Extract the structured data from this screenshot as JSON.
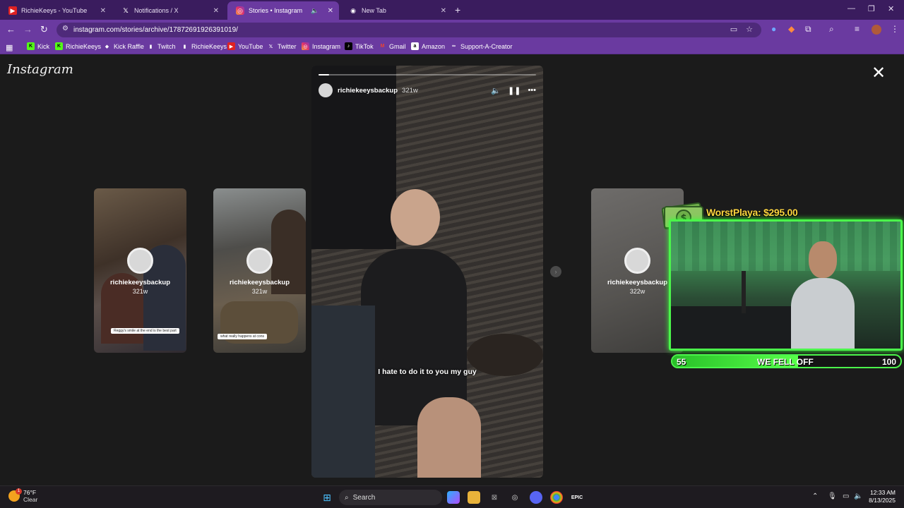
{
  "browser": {
    "tabs": [
      {
        "label": "RichieKeeys - YouTube",
        "icon": "youtube-icon",
        "active": false
      },
      {
        "label": "Notifications / X",
        "icon": "x-icon",
        "active": false
      },
      {
        "label": "Stories • Instagram",
        "icon": "instagram-icon",
        "active": true
      },
      {
        "label": "New Tab",
        "icon": "chrome-icon",
        "active": false
      }
    ],
    "url": "instagram.com/stories/archive/17872691926391019/",
    "bookmarks": [
      {
        "label": "Kick",
        "icon": "kick-icon"
      },
      {
        "label": "RichieKeeys",
        "icon": "kick-icon"
      },
      {
        "label": "Kick Raffle",
        "icon": "diamond-icon"
      },
      {
        "label": "Twitch",
        "icon": "twitch-icon"
      },
      {
        "label": "RichieKeeys",
        "icon": "twitch-icon"
      },
      {
        "label": "YouTube",
        "icon": "youtube-icon"
      },
      {
        "label": "Twitter",
        "icon": "x-icon"
      },
      {
        "label": "Instagram",
        "icon": "instagram-icon"
      },
      {
        "label": "TikTok",
        "icon": "tiktok-icon"
      },
      {
        "label": "Gmail",
        "icon": "gmail-icon"
      },
      {
        "label": "Amazon",
        "icon": "amazon-icon"
      },
      {
        "label": "Support-A-Creator",
        "icon": "epic-icon"
      }
    ]
  },
  "instagram": {
    "logo": "Instagram",
    "side_stories": [
      {
        "username": "richiekeeysbackup",
        "age": "321w",
        "caption": "Reggy's smile at the end is the best part"
      },
      {
        "username": "richiekeeysbackup",
        "age": "321w",
        "caption": "what really happens at cons"
      },
      {
        "username": "richiekeeysbackup",
        "age": "322w",
        "caption": ""
      }
    ],
    "main_story": {
      "username": "richiekeeysbackup",
      "age": "321w",
      "progress": 0.05,
      "caption": "I hate to do it to you my guy"
    }
  },
  "stream_overlay": {
    "donation": "WorstPlaya: $295.00",
    "goal": {
      "current": "55",
      "label": "WE FELL OFF",
      "target": "100",
      "fraction": 0.55
    },
    "colors": {
      "accent": "#4bf54b",
      "donation": "#ffd640"
    }
  },
  "taskbar": {
    "weather": {
      "temp": "76°F",
      "condition": "Clear",
      "badge": "1"
    },
    "search_placeholder": "Search",
    "time": "12:33 AM",
    "date": "8/13/2025"
  }
}
